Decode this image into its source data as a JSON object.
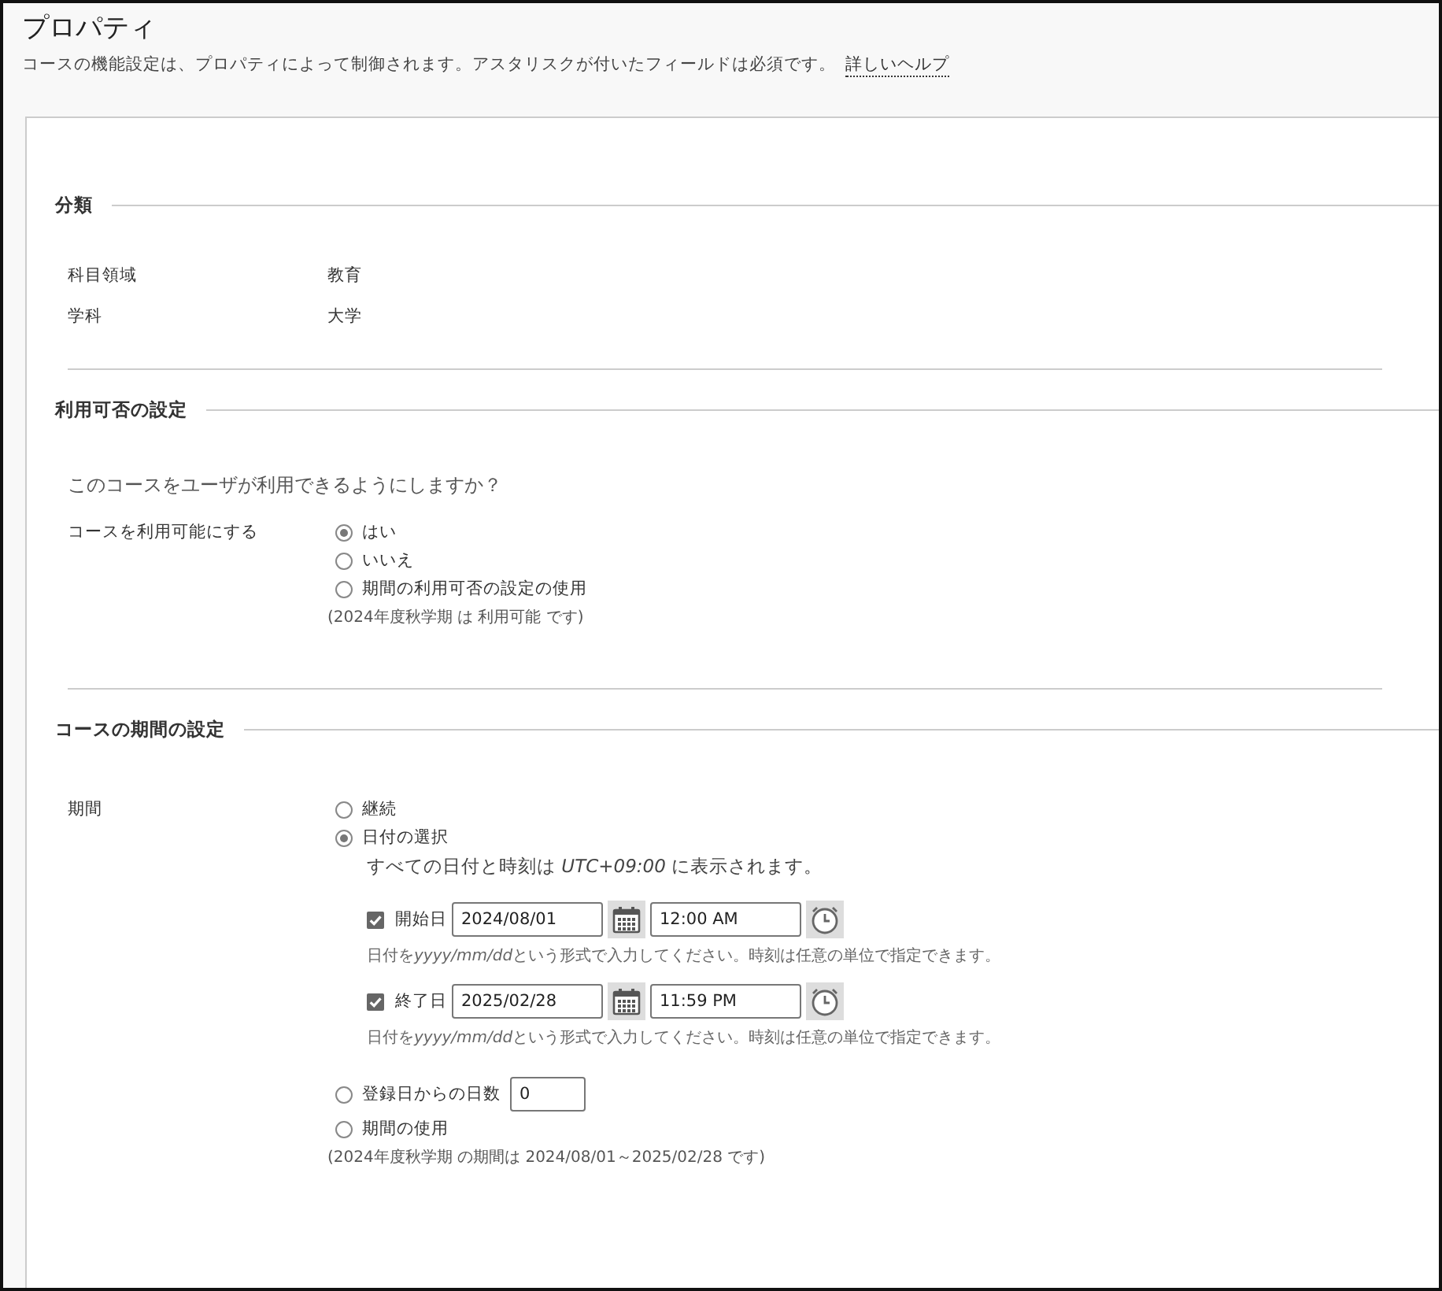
{
  "title": "プロパティ",
  "description": "コースの機能設定は、プロパティによって制御されます。アスタリスクが付いたフィールドは必須です。",
  "help_link": "詳しいヘルプ",
  "sections": [
    {
      "kind": "fields",
      "heading": "分類",
      "fields": [
        {
          "label": "科目領域",
          "value": "教育"
        },
        {
          "label": "学科",
          "value": "大学"
        }
      ]
    },
    {
      "kind": "availability",
      "heading": "利用可否の設定",
      "question": "このコースをユーザが利用できるようにしますか？",
      "label": "コースを利用可能にする",
      "options": [
        {
          "kind": "plain",
          "label": "はい",
          "selected": true
        },
        {
          "kind": "plain",
          "label": "いいえ",
          "selected": false
        },
        {
          "kind": "plain",
          "label": "期間の利用可否の設定の使用",
          "selected": false
        }
      ],
      "note": "(2024年度秋学期 は 利用可能 です)"
    },
    {
      "kind": "duration",
      "heading": "コースの期間の設定",
      "label": "期間",
      "options": [
        {
          "kind": "plain",
          "label": "継続",
          "selected": false
        },
        {
          "kind": "dates",
          "label": "日付の選択",
          "selected": true,
          "timezone_note": "すべての日付と時刻は *UTC+09:00* に表示されます。",
          "dates": [
            {
              "label": "開始日",
              "checked": true,
              "date": "2024/08/01",
              "time": "12:00 AM",
              "hint_before": "日付を",
              "hint_format": "yyyy/mm/dd",
              "hint_after": "という形式で入力してください。時刻は任意の単位で指定できます。"
            },
            {
              "label": "終了日",
              "checked": true,
              "date": "2025/02/28",
              "time": "11:59 PM",
              "hint_before": "日付を",
              "hint_format": "yyyy/mm/dd",
              "hint_after": "という形式で入力してください。時刻は任意の単位で指定できます。"
            }
          ]
        },
        {
          "kind": "days",
          "label": "登録日からの日数",
          "selected": false,
          "value": "0"
        },
        {
          "kind": "term",
          "label": "期間の使用",
          "selected": false,
          "note": "(2024年度秋学期 の期間は 2024/08/01～2025/02/28 です)"
        }
      ]
    }
  ]
}
